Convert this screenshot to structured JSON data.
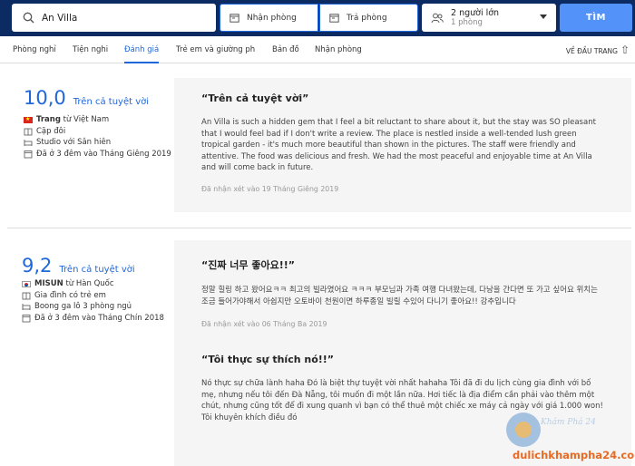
{
  "search": {
    "destination": "An Villa",
    "checkin_label": "Nhận phòng",
    "checkout_label": "Trả phòng",
    "guests_main": "2 người lớn",
    "guests_sub": "1 phòng",
    "search_button": "TÌM"
  },
  "tabs": [
    {
      "label": "Phòng nghỉ"
    },
    {
      "label": "Tiện nghi"
    },
    {
      "label": "Đánh giá",
      "active": true
    },
    {
      "label": "Trẻ em và giường ph"
    },
    {
      "label": "Bản đồ"
    },
    {
      "label": "Nhận phòng"
    }
  ],
  "back_to_top": "VỀ ĐẦU TRANG",
  "reviews": [
    {
      "score": "10,0",
      "score_label": "Trên cả tuyệt vời",
      "reviewer_name": "Trang",
      "reviewer_from": " từ Việt Nam",
      "traveler_type": "Cặp đôi",
      "room_type": "Studio với Sân hiên",
      "stay": "Đã ở 3 đêm vào Tháng Giêng 2019",
      "title": "“Trên cả tuyệt vời”",
      "body": "An Villa is such a hidden gem that I feel a bit reluctant to share about it, but the stay was SO pleasant that I would feel bad if I don't write a review. The place is nestled inside a well-tended lush green tropical garden - it's much more beautiful than shown in the pictures. The staff were friendly and attentive. The food was delicious and fresh. We had the most peaceful and enjoyable time at An Villa and will come back in future.",
      "date": "Đã nhận xét vào 19 Tháng Giêng 2019"
    },
    {
      "score": "9,2",
      "score_label": "Trên cả tuyệt vời",
      "reviewer_name": "MISUN",
      "reviewer_from": " từ Hàn Quốc",
      "traveler_type": "Gia đình có trẻ em",
      "room_type": "Boong ga lô 3 phòng ngủ",
      "stay": "Đã ở 3 đêm vào Tháng Chín 2018",
      "title": "“진짜 너무 좋아요!!”",
      "body": "정말 힐링 하고 왔어요ㅋㅋ 최고의 빌라였어요 ㅋㅋㅋ 부모님과 가족 여행 다녀왔는데, 다낭을 간다면 또 가고 싶어요 위치는 조금 들어가야해서 아쉽지만 오토바이 천원이면 하루종일 빌릴 수있어 다니기 좋아요!! 강추입니다",
      "date": "Đã nhận xét vào 06 Tháng Ba 2019"
    }
  ],
  "third_review": {
    "title": "“Tôi thực sự thích nó!!”",
    "body": "Nó thực sự chữa lành haha Đó là biệt thự tuyệt vời nhất hahaha Tôi đã đi du lịch cùng gia đình với bố mẹ, nhưng nếu tôi đến Đà Nẵng, tôi muốn đi một lần nữa. Hơi tiếc là địa điểm cần phải vào thêm một chút, nhưng cũng tốt để đi xung quanh vì bạn có thể thuê một chiếc xe máy cả ngày với giá 1.000 won! Tôi khuyên khích điều đó"
  },
  "watermark": {
    "script": "Khám Phá 24",
    "domain": "dulichkhampha24.com"
  }
}
